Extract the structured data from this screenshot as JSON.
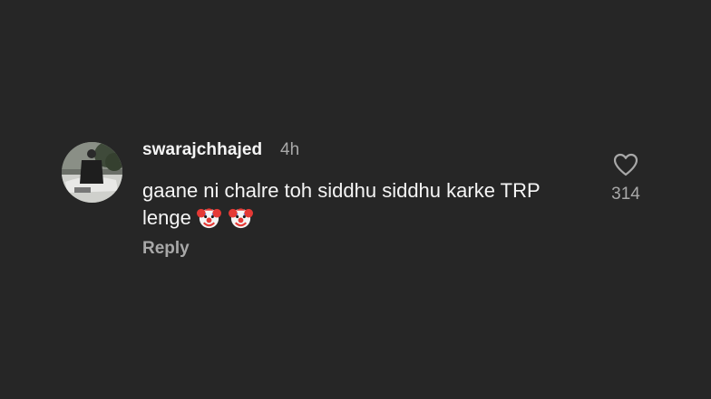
{
  "comment": {
    "username": "swarajchhajed",
    "timestamp": "4h",
    "text": "gaane ni chalre toh siddhu siddhu karke TRP lenge",
    "emojis": [
      "clown-face",
      "clown-face"
    ],
    "reply_label": "Reply",
    "like_count": "314"
  },
  "colors": {
    "background": "#262626",
    "primary_text": "#f5f5f5",
    "secondary_text": "#a8a8a8"
  },
  "icons": {
    "like": "heart-outline-icon",
    "avatar": "profile-photo"
  }
}
